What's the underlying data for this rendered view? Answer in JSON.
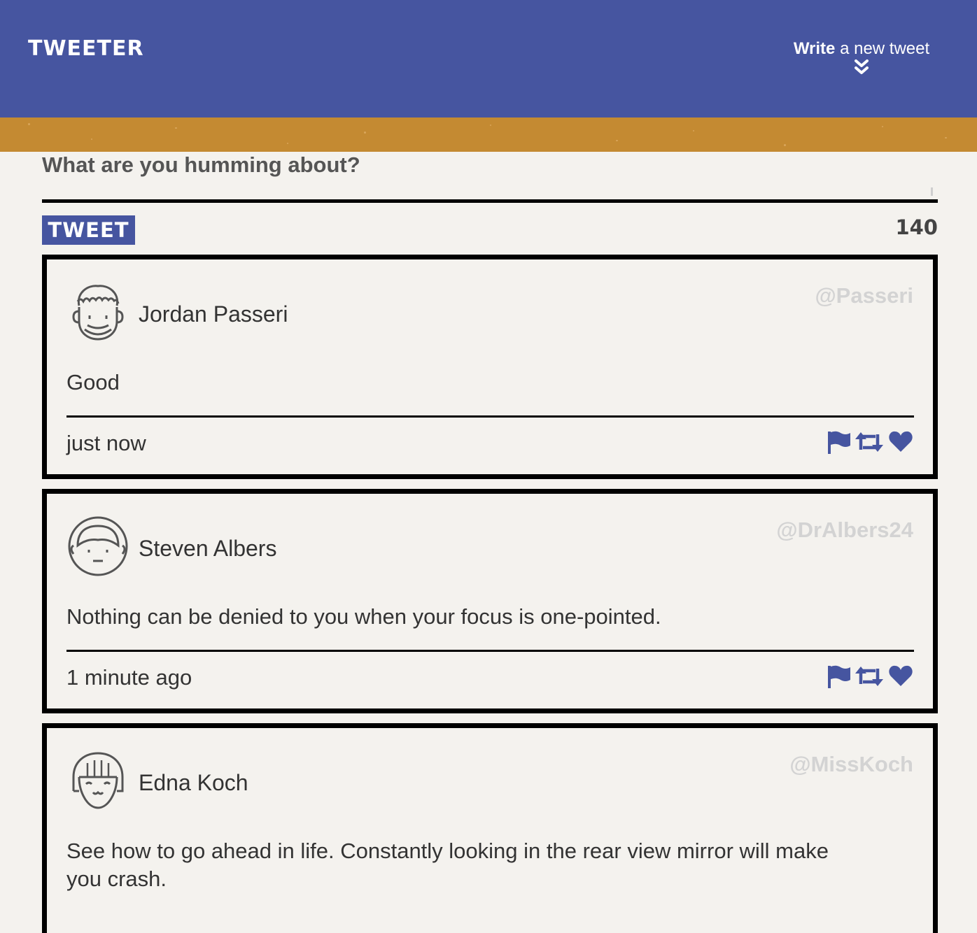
{
  "header": {
    "brand": "TWEETER",
    "compose_bold": "Write",
    "compose_rest": " a new tweet"
  },
  "composer": {
    "question": "What are you humming about?",
    "submit_label": "TWEET",
    "counter": "140"
  },
  "tweets": [
    {
      "name": "Jordan Passeri",
      "handle": "@Passeri",
      "text": "Good",
      "time": "just now"
    },
    {
      "name": "Steven Albers",
      "handle": "@DrAlbers24",
      "text": "Nothing can be denied to you when your focus is one-pointed.",
      "time": "1 minute ago"
    },
    {
      "name": "Edna Koch",
      "handle": "@MissKoch",
      "text": "See how to go ahead in life. Constantly looking in the rear view mirror will make you crash.",
      "time": ""
    }
  ],
  "colors": {
    "header": "#4655a0",
    "banner": "#c48a32",
    "background": "#f4f2ee",
    "accent": "#4655a0",
    "handle": "#d3d3d3"
  },
  "icons": [
    "chevron-double-down-icon",
    "flag-icon",
    "retweet-icon",
    "heart-icon",
    "avatar-icon"
  ]
}
